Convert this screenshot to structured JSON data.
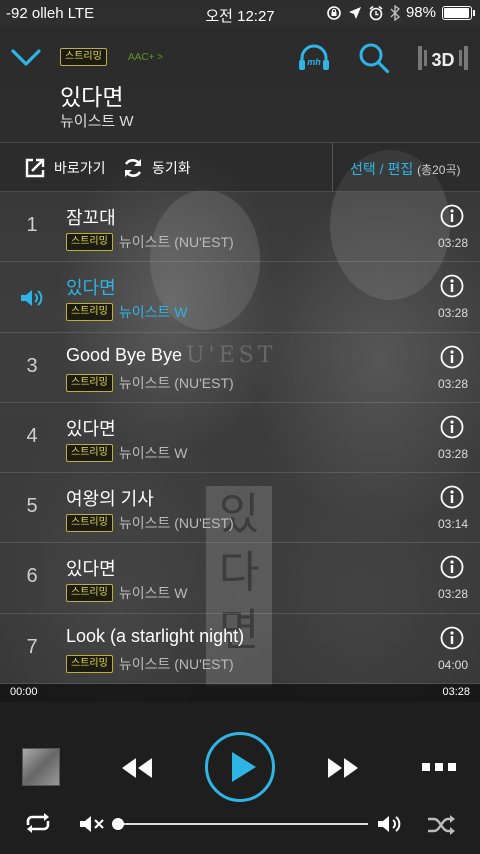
{
  "status": {
    "carrier": "-92 olleh  LTE",
    "time": "오전 12:27",
    "battery": "98%",
    "battery_level": 0.98
  },
  "header": {
    "badge": "스트리밍",
    "codec": "AAC+ >",
    "title": "있다면",
    "artist": "뉴이스트 W",
    "icons": [
      "chevron-down-icon",
      "mh-headphones-icon",
      "search-icon",
      "3d-sound-icon"
    ]
  },
  "toolbar": {
    "goto_label": "바로가기",
    "sync_label": "동기화",
    "select_label": "선택",
    "separator": " / ",
    "edit_label": "편집",
    "count_label": "(총20곡)"
  },
  "tracks": [
    {
      "num": "1",
      "title": "잠꼬대",
      "badge": "스트리밍",
      "artist": "뉴이스트 (NU'EST)",
      "duration": "03:28",
      "playing": false
    },
    {
      "num": "",
      "title": "있다면",
      "badge": "스트리밍",
      "artist": "뉴이스트 W",
      "duration": "03:28",
      "playing": true
    },
    {
      "num": "3",
      "title": "Good Bye Bye",
      "badge": "스트리밍",
      "artist": "뉴이스트 (NU'EST)",
      "duration": "03:28",
      "playing": false
    },
    {
      "num": "4",
      "title": "있다면",
      "badge": "스트리밍",
      "artist": "뉴이스트 W",
      "duration": "03:28",
      "playing": false
    },
    {
      "num": "5",
      "title": "여왕의 기사",
      "badge": "스트리밍",
      "artist": "뉴이스트 (NU'EST)",
      "duration": "03:14",
      "playing": false
    },
    {
      "num": "6",
      "title": "있다면",
      "badge": "스트리밍",
      "artist": "뉴이스트 W",
      "duration": "03:28",
      "playing": false
    },
    {
      "num": "7",
      "title": "Look (a starlight night)",
      "badge": "스트리밍",
      "artist": "뉴이스트 (NU'EST)",
      "duration": "04:00",
      "playing": false
    }
  ],
  "progress": {
    "elapsed": "00:00",
    "total": "03:28",
    "fraction": 0.0
  },
  "player": {
    "volume": 0.0,
    "accent": "#2fb4e6"
  }
}
